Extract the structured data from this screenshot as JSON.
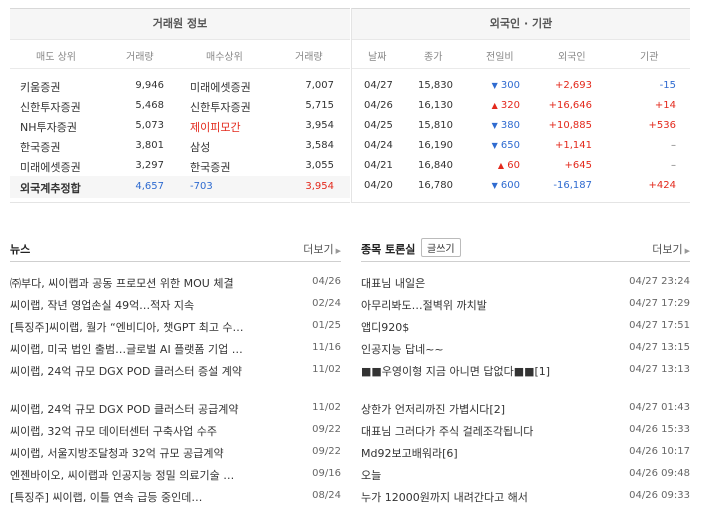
{
  "trader": {
    "title": "거래원 정보",
    "headers": [
      "매도 상위",
      "거래량",
      "매수상위",
      "거래량"
    ],
    "rows": [
      {
        "sell": "키움증권",
        "sell_vol": "9,946",
        "buy": "미래에셋증권",
        "buy_vol": "7,007"
      },
      {
        "sell": "신한투자증권",
        "sell_vol": "5,468",
        "buy": "신한투자증권",
        "buy_vol": "5,715"
      },
      {
        "sell": "NH투자증권",
        "sell_vol": "5,073",
        "buy": "제이피모간",
        "buy_vol": "3,954"
      },
      {
        "sell": "한국증권",
        "sell_vol": "3,801",
        "buy": "삼성",
        "buy_vol": "3,584"
      },
      {
        "sell": "미래에셋증권",
        "sell_vol": "3,297",
        "buy": "한국증권",
        "buy_vol": "3,055"
      }
    ],
    "foreign": {
      "label": "외국계추정합",
      "sell_vol": "4,657",
      "net": "-703",
      "buy_vol": "3,954"
    },
    "highlight_color": "#e3291c"
  },
  "institution": {
    "title": "외국인 · 기관",
    "headers": [
      "날짜",
      "종가",
      "전일비",
      "외국인",
      "기관"
    ],
    "rows": [
      {
        "date": "04/27",
        "close": "15,830",
        "dir": "down",
        "change": "300",
        "foreign": "+2,693",
        "inst": "-15"
      },
      {
        "date": "04/26",
        "close": "16,130",
        "dir": "up",
        "change": "320",
        "foreign": "+16,646",
        "inst": "+14"
      },
      {
        "date": "04/25",
        "close": "15,810",
        "dir": "down",
        "change": "380",
        "foreign": "+10,885",
        "inst": "+536"
      },
      {
        "date": "04/24",
        "close": "16,190",
        "dir": "down",
        "change": "650",
        "foreign": "+1,141",
        "inst": "–"
      },
      {
        "date": "04/21",
        "close": "16,840",
        "dir": "up",
        "change": "60",
        "foreign": "+645",
        "inst": "–"
      },
      {
        "date": "04/20",
        "close": "16,780",
        "dir": "down",
        "change": "600",
        "foreign": "-16,187",
        "inst": "+424"
      }
    ],
    "up_arrow": "▲",
    "down_arrow": "▼",
    "up_color": "#e3291c",
    "down_color": "#2f6bd0"
  },
  "news": {
    "title": "뉴스",
    "more": "더보기",
    "items": [
      {
        "title": "㈜부다, 씨이랩과 공동 프로모션 위한 MOU 체결",
        "date": "04/26"
      },
      {
        "title": "씨이랩, 작년 영업손실 49억…적자 지속",
        "date": "02/24"
      },
      {
        "title": "[특징주]씨이랩, 월가 “엔비디아, 챗GPT 최고 수…",
        "date": "01/25"
      },
      {
        "title": "씨이랩, 미국 법인 출범…글로벌 AI 플랫폼 기업 …",
        "date": "11/16"
      },
      {
        "title": "씨이랩, 24억 규모 DGX POD 클러스터 증설 계약",
        "date": "11/02"
      },
      {
        "title": "씨이랩, 24억 규모 DGX POD 클러스터 공급계약",
        "date": "11/02"
      },
      {
        "title": "씨이랩, 32억 규모 데이터센터 구축사업 수주",
        "date": "09/22"
      },
      {
        "title": "씨이랩, 서울지방조달청과 32억 규모 공급계약",
        "date": "09/22"
      },
      {
        "title": "엔젠바이오, 씨이랩과 인공지능 정밀 의료기술 …",
        "date": "09/16"
      },
      {
        "title": "[특징주] 씨이랩, 이틀 연속 급등 중인데…",
        "date": "08/24"
      }
    ]
  },
  "board": {
    "title": "종목 토론실",
    "write": "글쓰기",
    "more": "더보기",
    "items": [
      {
        "title": "대표님 내일은",
        "date": "04/27 23:24"
      },
      {
        "title": "아무리봐도…절벽위 까치발",
        "date": "04/27 17:29"
      },
      {
        "title": "앱디920$",
        "date": "04/27 17:51"
      },
      {
        "title": "인공지능 답네~~",
        "date": "04/27 13:15"
      },
      {
        "title": "■■우영이형 지금 아니면 답없다■■[1]",
        "date": "04/27 13:13"
      },
      {
        "title": "상한가 언저리까진 가볍시다[2]",
        "date": "04/27 01:43"
      },
      {
        "title": "대표님 그러다가 주식 걸레조각됩니다",
        "date": "04/26 15:33"
      },
      {
        "title": "Md92보고배워라[6]",
        "date": "04/26 10:17"
      },
      {
        "title": "오늘",
        "date": "04/26 09:48"
      },
      {
        "title": "누가 12000원까지 내려간다고 해서",
        "date": "04/26 09:33"
      }
    ]
  }
}
